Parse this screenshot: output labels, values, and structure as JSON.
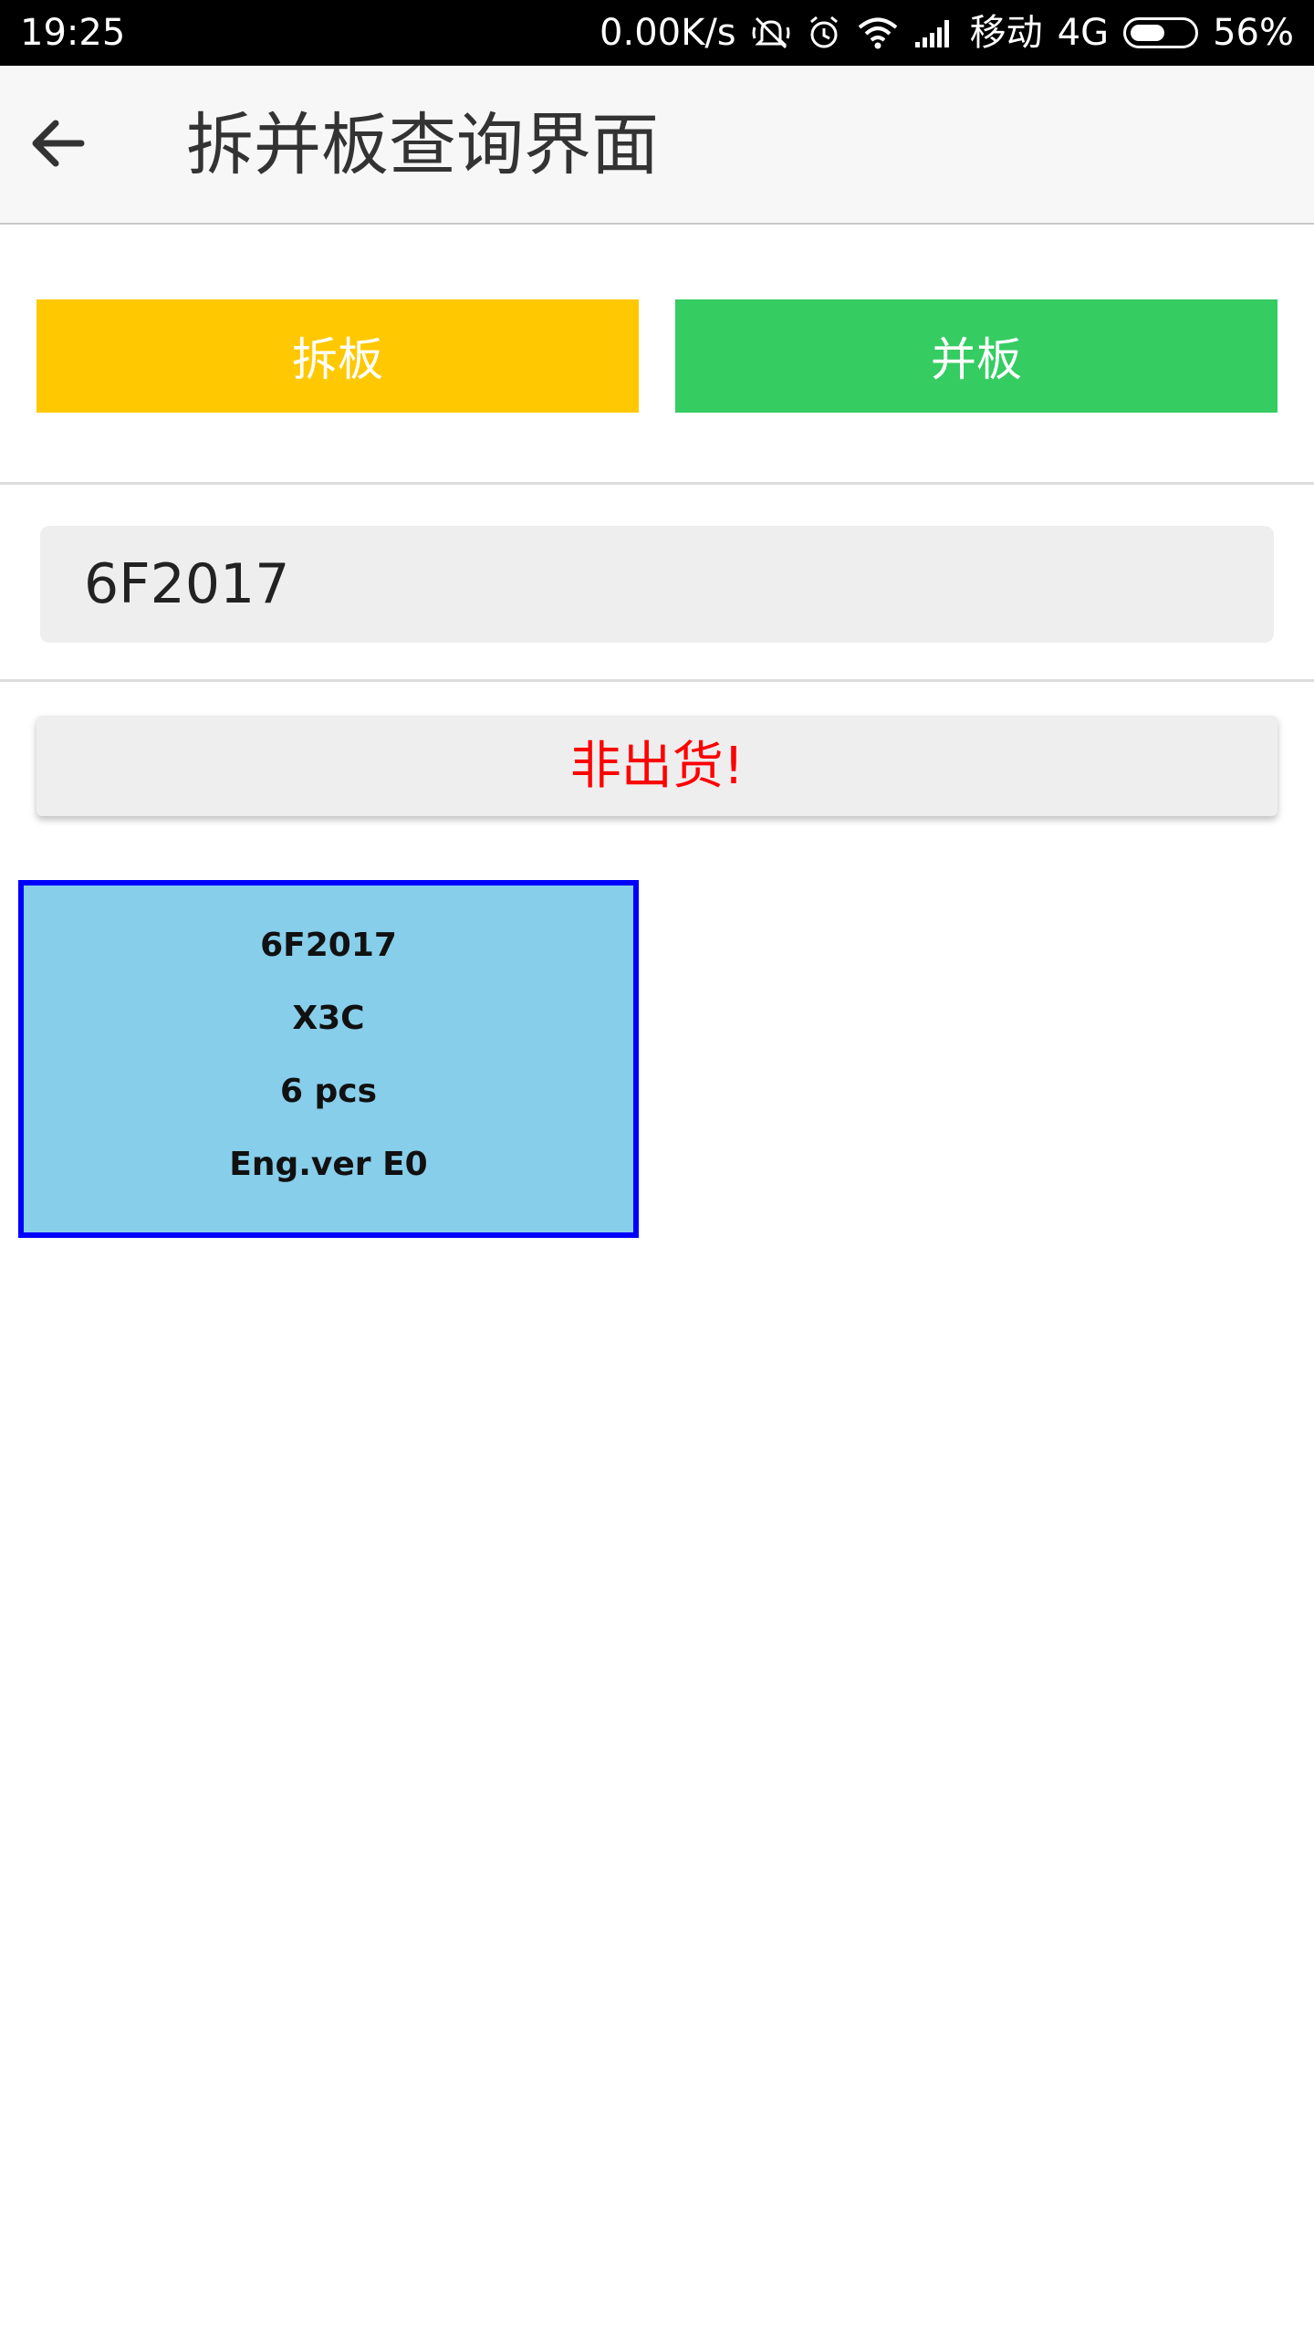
{
  "status_bar": {
    "time": "19:25",
    "net_speed": "0.00K/s",
    "carrier": "移动",
    "network": "4G",
    "battery": "56%",
    "battery_level": 0.56,
    "icons": [
      "mute-icon",
      "alarm-icon",
      "wifi-icon",
      "signal-icon",
      "battery-icon"
    ]
  },
  "app_bar": {
    "back_icon": "arrow-left-icon",
    "title": "拆并板查询界面"
  },
  "actions": {
    "split_label": "拆板",
    "merge_label": "并板",
    "split_color": "#ffc800",
    "merge_color": "#35cc62"
  },
  "barcode_input": {
    "value": "6F2017"
  },
  "result": {
    "text": "非出货!",
    "color": "#ff0000"
  },
  "pallet_card": {
    "barcode": "6F2017",
    "model": "X3C",
    "quantity": "6 pcs",
    "version": "Eng.ver E0",
    "fill_color": "#87ceeb",
    "border_color": "#0000ff"
  }
}
